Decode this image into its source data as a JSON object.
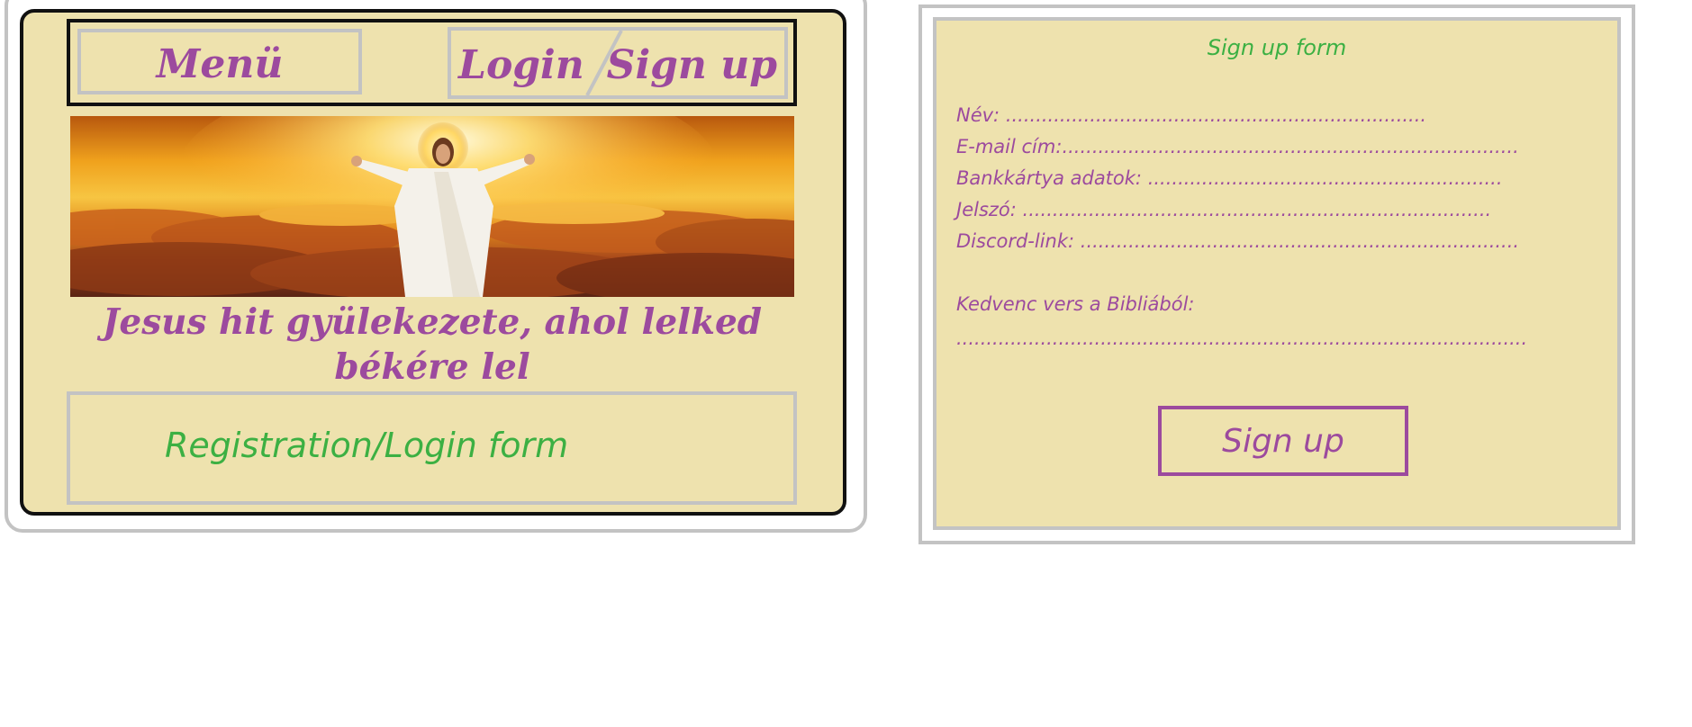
{
  "left_mockup": {
    "nav": {
      "menu_label": "Menü",
      "login_label": "Login",
      "signup_label": "Sign up"
    },
    "headline": "Jesus hit gyülekezete, ahol lelked békére lel",
    "form_placeholder": "Registration/Login form"
  },
  "signup_form": {
    "title": "Sign up form",
    "fields": [
      {
        "label": "Név: ",
        "dots": "......................................................................"
      },
      {
        "label": "E-mail cím:",
        "dots": "............................................................................"
      },
      {
        "label": "Bankkártya adatok: ",
        "dots": "..........................................................."
      },
      {
        "label": "Jelszó: ",
        "dots": ".............................................................................."
      },
      {
        "label": "Discord-link: ",
        "dots": "........................................................................."
      }
    ],
    "favorite_verse_label": "Kedvenc vers a Bibliából:",
    "favorite_verse_dots": "...............................................................................................",
    "submit_label": "Sign up"
  },
  "colors": {
    "panel_bg": "#eee2ae",
    "accent_purple": "#9c4a9e",
    "accent_green": "#3cb043",
    "border_gray": "#c3c3c3"
  }
}
